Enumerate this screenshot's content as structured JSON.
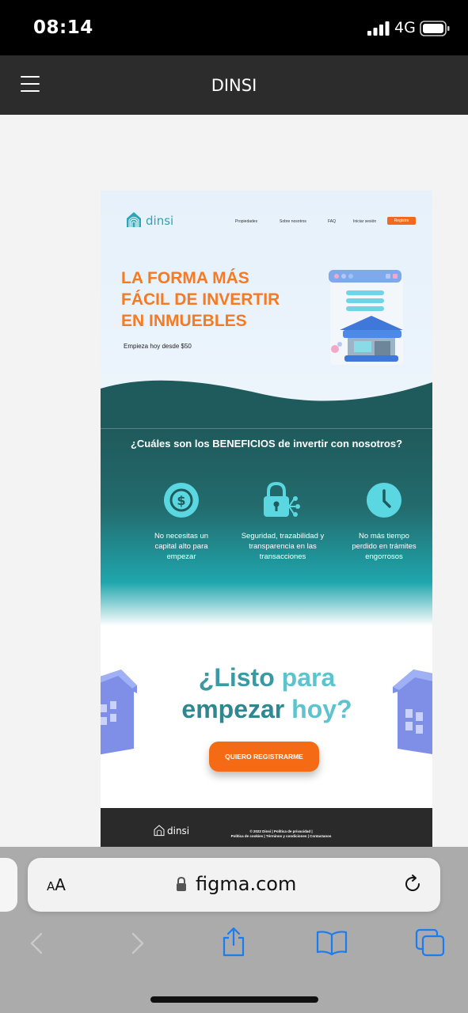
{
  "status_bar": {
    "time": "08:14",
    "network": "4G"
  },
  "prototype": {
    "title": "DINSI"
  },
  "site": {
    "logo": "dinsi",
    "nav": [
      "Propiedades",
      "Sobre nosotros",
      "FAQ",
      "Iniciar sesión"
    ],
    "nav_button": "Registro",
    "hero": {
      "title_lines": [
        "LA FORMA MÁS",
        "FÁCIL DE INVERTIR",
        "EN INMUEBLES"
      ],
      "subtitle": "Empieza hoy desde $50"
    },
    "benefits": {
      "title": "¿Cuáles son los BENEFICIOS de invertir con nosotros?",
      "items": [
        {
          "icon": "dollar-coin-icon",
          "lines": [
            "No necesitas un",
            "capital alto para",
            "empezar"
          ]
        },
        {
          "icon": "lock-network-icon",
          "lines": [
            "Seguridad, trazabilidad y",
            "transparencia en las",
            "transacciones"
          ]
        },
        {
          "icon": "clock-icon",
          "lines": [
            "No más tiempo",
            "perdido en trámites",
            "engorrosos"
          ]
        }
      ]
    },
    "cta": {
      "line1_a": "¿Listo ",
      "line1_b": "para",
      "line2_a": "empezar ",
      "line2_b": "hoy?",
      "button": "QUIERO REGISTRARME"
    },
    "footer": {
      "logo": "dinsi",
      "line1": "© 2022 Dinsi | Política de privacidad |",
      "line2": "Política de cookies | Términos y condiciones  |  Contactanos"
    }
  },
  "safari": {
    "text_size_label": "AA",
    "url": "figma.com"
  },
  "colors": {
    "accent_orange": "#f26b1d",
    "teal_dark": "#1f5a5c",
    "teal_light": "#5cc3cf",
    "ios_blue": "#1a7cf0"
  }
}
